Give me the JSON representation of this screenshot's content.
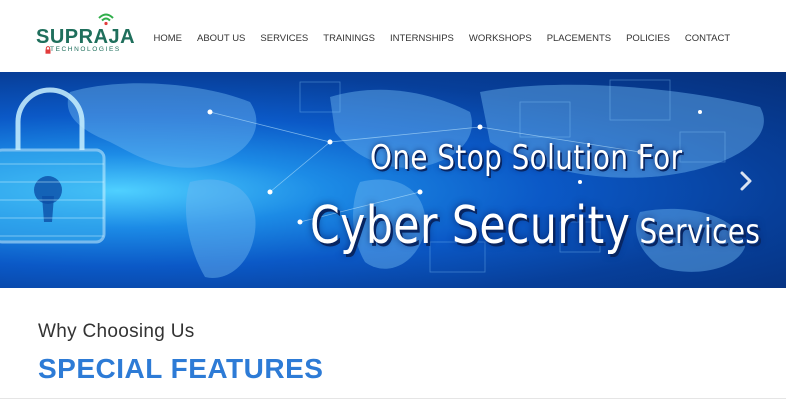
{
  "brand": {
    "name": "SUPRAJA",
    "tagline": "TECHNOLOGIES",
    "colors": {
      "primary": "#1f6f5c",
      "accent": "#e23b3b"
    },
    "icons": [
      "wifi-icon",
      "lock-icon"
    ]
  },
  "nav": {
    "items": [
      {
        "label": "HOME"
      },
      {
        "label": "ABOUT US"
      },
      {
        "label": "SERVICES"
      },
      {
        "label": "TRAININGS"
      },
      {
        "label": "INTERNSHIPS"
      },
      {
        "label": "WORKSHOPS"
      },
      {
        "label": "PLACEMENTS"
      },
      {
        "label": "POLICIES"
      },
      {
        "label": "CONTACT"
      }
    ]
  },
  "hero": {
    "line1": "One Stop Solution For",
    "line2_main": "Cyber Security",
    "line2_tail": " Services",
    "next_icon": "chevron-right-icon"
  },
  "section": {
    "subtitle": "Why Choosing Us",
    "title": "SPECIAL FEATURES",
    "title_color": "#2d7bd6"
  }
}
